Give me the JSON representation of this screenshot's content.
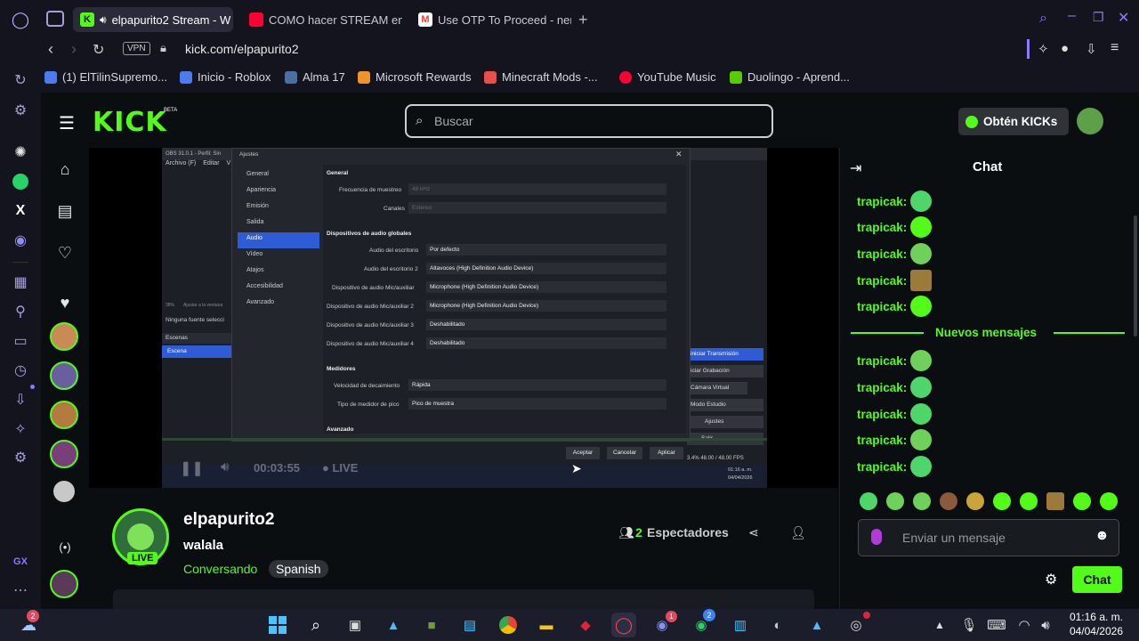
{
  "browser": {
    "tabs": [
      {
        "label": "elpapurito2 Stream - W"
      },
      {
        "label": "COMO hacer STREAM en"
      },
      {
        "label": "Use OTP To Proceed - nen"
      }
    ],
    "address": {
      "vpn_label": "VPN",
      "url": "kick.com/elpapurito2"
    },
    "bookmarks": [
      {
        "label": "(1) ElTilinSupremo..."
      },
      {
        "label": "Inicio - Roblox"
      },
      {
        "label": "Alma 17"
      },
      {
        "label": "Microsoft Rewards"
      },
      {
        "label": "Minecraft Mods -..."
      },
      {
        "label": "YouTube Music"
      },
      {
        "label": "Duolingo - Aprend..."
      }
    ],
    "sidebar_gx_label": "GX"
  },
  "kick": {
    "logo": "KICK",
    "logo_beta": "BETA",
    "search_placeholder": "Buscar",
    "get_kicks_label": "Obtén KICKs",
    "brand_color": "#53fc18"
  },
  "obs": {
    "window_title": "OBS 31.0.1 - Perfil: Sin",
    "dialog_title": "Ajustes",
    "menu": [
      "Archivo (F)",
      "Editar",
      "V"
    ],
    "categories": [
      "General",
      "Apariencia",
      "Emisión",
      "Salida",
      "Audio",
      "Vídeo",
      "Atajos",
      "Accesibilidad",
      "Avanzado"
    ],
    "selected_category": "Audio",
    "section_general": "General",
    "rows_general": [
      {
        "label": "Frecuencia de muestreo",
        "value": "48 kHz"
      },
      {
        "label": "Canales",
        "value": "Estéreo"
      }
    ],
    "section_devices": "Dispositivos de audio globales",
    "rows_devices": [
      {
        "label": "Audio del escritorio",
        "value": "Por defecto"
      },
      {
        "label": "Audio del escritorio 2",
        "value": "Altavoces (High Definition Audio Device)"
      },
      {
        "label": "Dispositivo de audio Mic/auxiliar",
        "value": "Microphone (High Definition Audio Device)"
      },
      {
        "label": "Dispositivo de audio Mic/auxiliar 2",
        "value": "Microphone (High Definition Audio Device)"
      },
      {
        "label": "Dispositivo de audio Mic/auxiliar 3",
        "value": "Deshabilitado"
      },
      {
        "label": "Dispositivo de audio Mic/auxiliar 4",
        "value": "Deshabilitado"
      }
    ],
    "section_meters": "Medidores",
    "rows_meters": [
      {
        "label": "Velocidad de decaimiento",
        "value": "Rápida"
      },
      {
        "label": "Tipo de medidor de pico",
        "value": "Pico de muestra"
      }
    ],
    "section_advanced": "Avanzado",
    "btn_accept": "Aceptar",
    "btn_cancel": "Cancelar",
    "btn_apply": "Aplicar",
    "bg_no_source": "Ninguna fuente selecci",
    "bg_scenes_header": "Escenas",
    "bg_scene": "Escena",
    "bg_controls": [
      "iniciar Transmisión",
      "iciar Grabación",
      "Cámara Virtual",
      "Modo Estudio",
      "Ajustes",
      "Salir"
    ],
    "bg_status": "3.4%  48.00 / 48.00 FPS",
    "bg_clock": "01:16 a. m.",
    "bg_date": "04/04/2026",
    "bg_percent": "38%",
    "bg_adjust": "Ajustar a la ventana"
  },
  "player": {
    "time": "00:03:55",
    "live": "LIVE"
  },
  "channel": {
    "name": "elpapurito2",
    "title": "walala",
    "category": "Conversando",
    "language": "Spanish",
    "live_badge": "LIVE",
    "viewers_count": "2",
    "viewers_label": "Espectadores"
  },
  "chat": {
    "header": "Chat",
    "messages": [
      {
        "user": "trapicak:"
      },
      {
        "user": "trapicak:"
      },
      {
        "user": "trapicak:"
      },
      {
        "user": "trapicak:"
      },
      {
        "user": "trapicak:"
      }
    ],
    "divider": "Nuevos mensajes",
    "messages_new": [
      {
        "user": "trapicak:"
      },
      {
        "user": "trapicak:"
      },
      {
        "user": "trapicak:"
      },
      {
        "user": "trapicak:"
      },
      {
        "user": "trapicak:"
      }
    ],
    "input_placeholder": "Enviar un mensaje",
    "send_label": "Chat"
  },
  "taskbar": {
    "time": "01:16 a. m.",
    "date": "04/04/2026",
    "weather_badge": "2",
    "discord_badge": "1",
    "whatsapp_badge": "2"
  }
}
